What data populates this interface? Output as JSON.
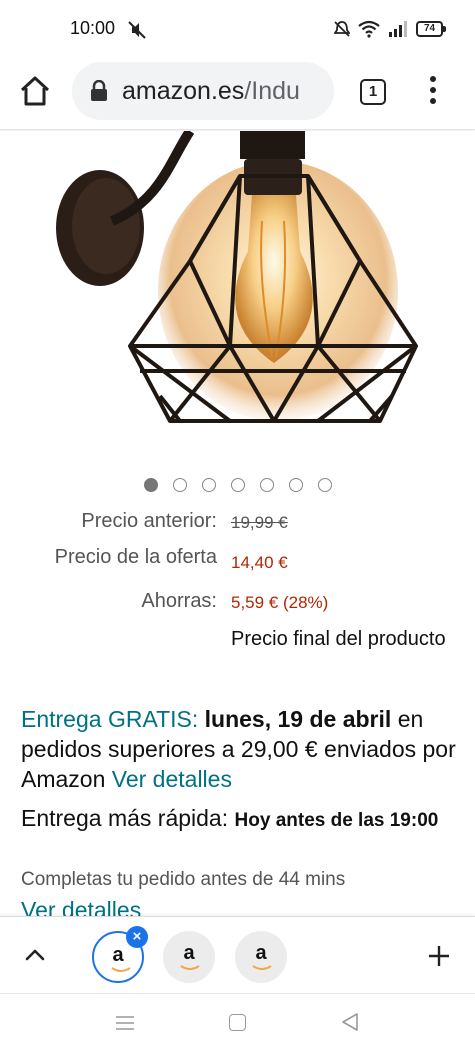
{
  "status_bar": {
    "time": "10:00",
    "battery": "74",
    "icons": [
      "mute-icon",
      "alarm-off-icon",
      "wifi-icon",
      "signal-icon",
      "battery-icon"
    ]
  },
  "browser": {
    "url_domain": "amazon.es",
    "url_path": "/Indu",
    "tab_count": "1",
    "icons": [
      "home-icon",
      "lock-icon",
      "tab-switcher-icon",
      "menu-dots-icon"
    ]
  },
  "product": {
    "image_desc_icon": "wall-lamp-image",
    "carousel_total": 7,
    "carousel_active": 0
  },
  "price": {
    "previous_label": "Precio anterior:",
    "previous_value": "19,99 €",
    "offer_label": "Precio de la oferta",
    "offer_value": "14,40 €",
    "savings_label": "Ahorras:",
    "savings_value": "5,59 € (28%)",
    "final_note": "Precio final del producto"
  },
  "delivery": {
    "free_label": "Entrega GRATIS:",
    "date": "lunes, 19 de abril",
    "condition": "en pedidos superiores a 29,00 € enviados por Amazon",
    "details_link": "Ver detalles",
    "faster_label": "Entrega más rápida:",
    "faster_time": "Hoy antes de las 19:00",
    "complete_note": "Completas tu pedido antes de 44 mins",
    "details_link_2": "Ver detalles"
  },
  "tab_strip": {
    "tab_logo": "a",
    "close_symbol": "×",
    "tab_count": 3
  },
  "colors": {
    "teal_link": "#007185",
    "price_red": "#b12704",
    "active_tab_blue": "#1a73e8"
  }
}
